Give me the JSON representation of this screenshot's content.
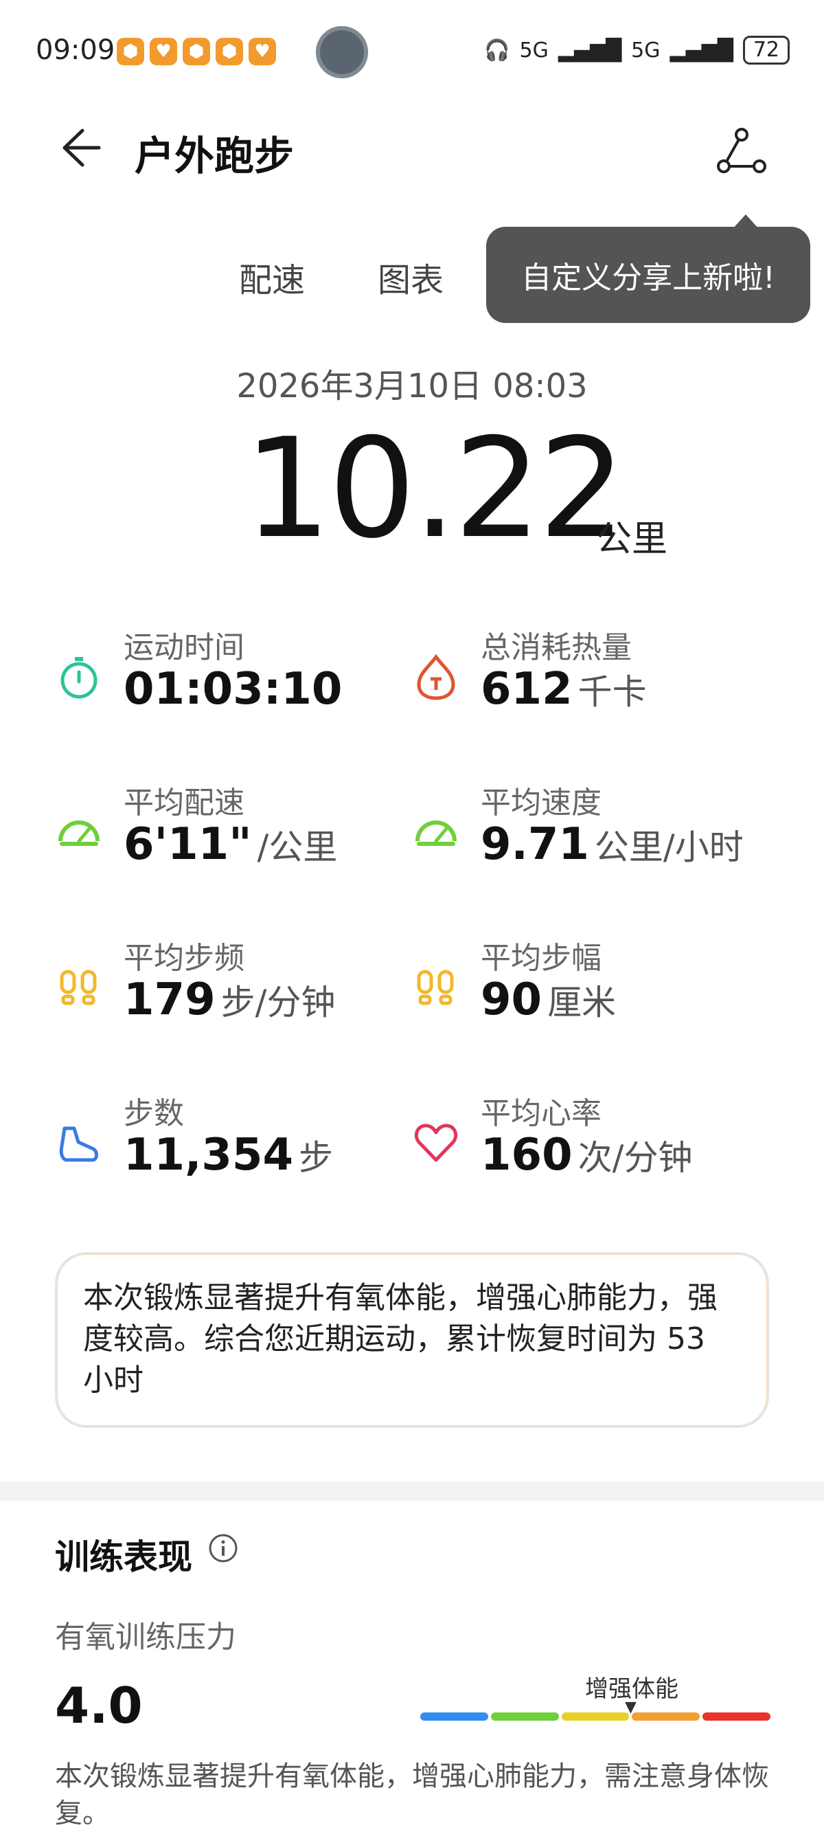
{
  "status_bar": {
    "time": "09:09",
    "battery": "72",
    "signal": "5G"
  },
  "header": {
    "title": "户外跑步"
  },
  "tabs": {
    "pace": "配速",
    "chart": "图表"
  },
  "tooltip": {
    "text": "自定义分享上新啦!"
  },
  "summary": {
    "datetime": "2026年3月10日 08:03",
    "distance": "10.22",
    "distance_unit": "公里"
  },
  "metrics": [
    {
      "label": "运动时间",
      "value": "01:03:10",
      "unit": "",
      "icon": "stopwatch-icon"
    },
    {
      "label": "总消耗热量",
      "value": "612",
      "unit": "千卡",
      "icon": "calorie-flame-icon"
    },
    {
      "label": "平均配速",
      "value": "6'11\"",
      "unit": "/公里",
      "icon": "speedometer-icon"
    },
    {
      "label": "平均速度",
      "value": "9.71",
      "unit": "公里/小时",
      "icon": "speedometer-icon"
    },
    {
      "label": "平均步频",
      "value": "179",
      "unit": "步/分钟",
      "icon": "footprints-icon"
    },
    {
      "label": "平均步幅",
      "value": "90",
      "unit": "厘米",
      "icon": "footprints-icon"
    },
    {
      "label": "步数",
      "value": "11,354",
      "unit": "步",
      "icon": "shoe-icon"
    },
    {
      "label": "平均心率",
      "value": "160",
      "unit": "次/分钟",
      "icon": "heart-icon"
    }
  ],
  "insight": {
    "text": "本次锻炼显著提升有氧体能，增强心肺能力，强度较高。综合您近期运动，累计恢复时间为 53 小时"
  },
  "training": {
    "section_title": "训练表现",
    "subsection": "有氧训练压力",
    "score": "4.0",
    "scale_label": "增强体能",
    "scale_position": 0.6,
    "scale_colors": [
      "#2f8ef0",
      "#6fcf3b",
      "#e6d12a",
      "#f0a030",
      "#e8332c"
    ],
    "description": "本次锻炼显著提升有氧体能，增强心肺能力，需注意身体恢复。"
  }
}
